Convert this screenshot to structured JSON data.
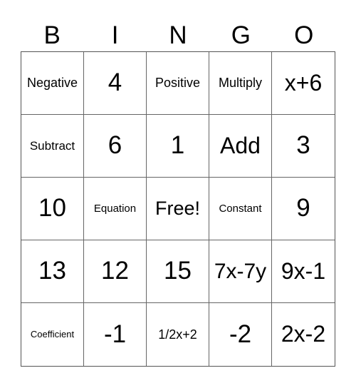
{
  "header": {
    "letters": [
      "B",
      "I",
      "N",
      "G",
      "O"
    ]
  },
  "grid": {
    "rows": [
      [
        "Negative",
        "4",
        "Positive",
        "Multiply",
        "x+6"
      ],
      [
        "Subtract",
        "6",
        "1",
        "Add",
        "3"
      ],
      [
        "10",
        "Equation",
        "Free!",
        "Constant",
        "9"
      ],
      [
        "13",
        "12",
        "15",
        "7x-7y",
        "9x-1"
      ],
      [
        "Coefficient",
        "-1",
        "1/2x+2",
        "-2",
        "2x-2"
      ]
    ]
  }
}
